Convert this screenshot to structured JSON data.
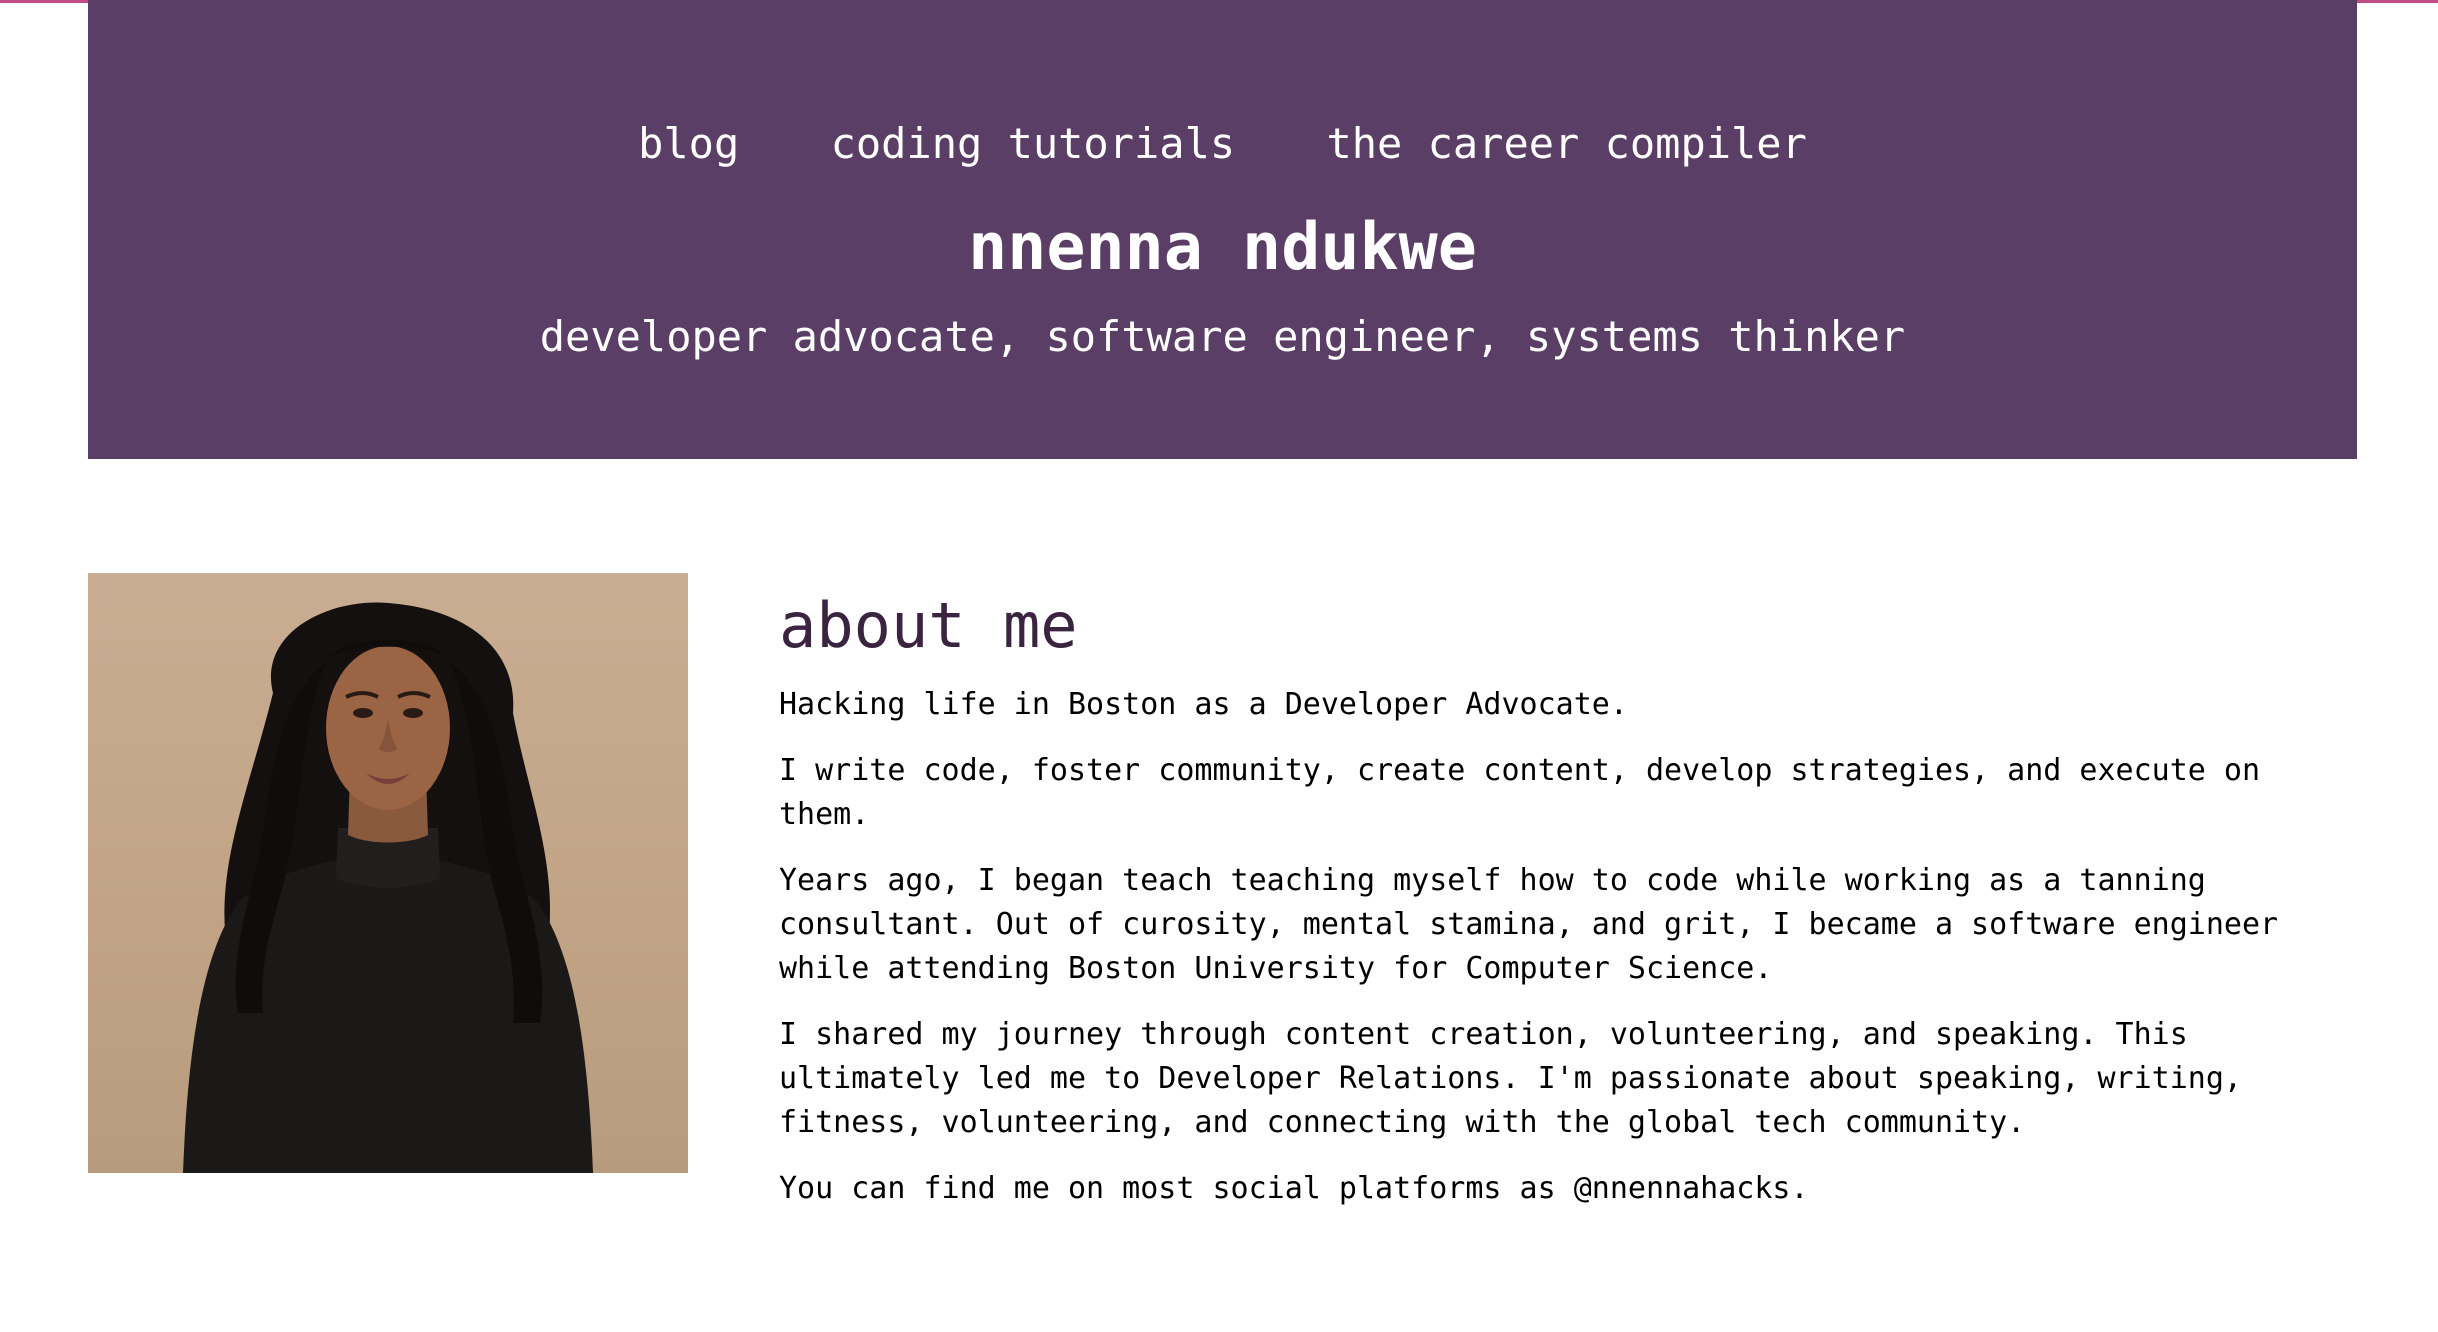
{
  "nav": {
    "items": [
      {
        "label": "blog"
      },
      {
        "label": "coding tutorials"
      },
      {
        "label": "the career compiler"
      }
    ]
  },
  "header": {
    "title": "nnenna ndukwe",
    "subtitle": "developer advocate, software engineer, systems thinker"
  },
  "about": {
    "heading": "about me",
    "paragraphs": [
      "Hacking life in Boston as a Developer Advocate.",
      "I write code, foster community, create content, develop strategies, and execute on them.",
      "Years ago, I began teach teaching myself how to code while working as a tanning consultant. Out of curosity, mental stamina, and grit, I became a software engineer while attending Boston University for Computer Science.",
      "I shared my journey through content creation, volunteering, and speaking. This ultimately led me to Developer Relations. I'm passionate about speaking, writing, fitness, volunteering, and connecting with the global tech community.",
      "You can find me on most social platforms as @nnennahacks."
    ]
  },
  "colors": {
    "header_bg": "#5a3e66",
    "accent_line": "#c04c84",
    "heading_text": "#3b2440"
  }
}
